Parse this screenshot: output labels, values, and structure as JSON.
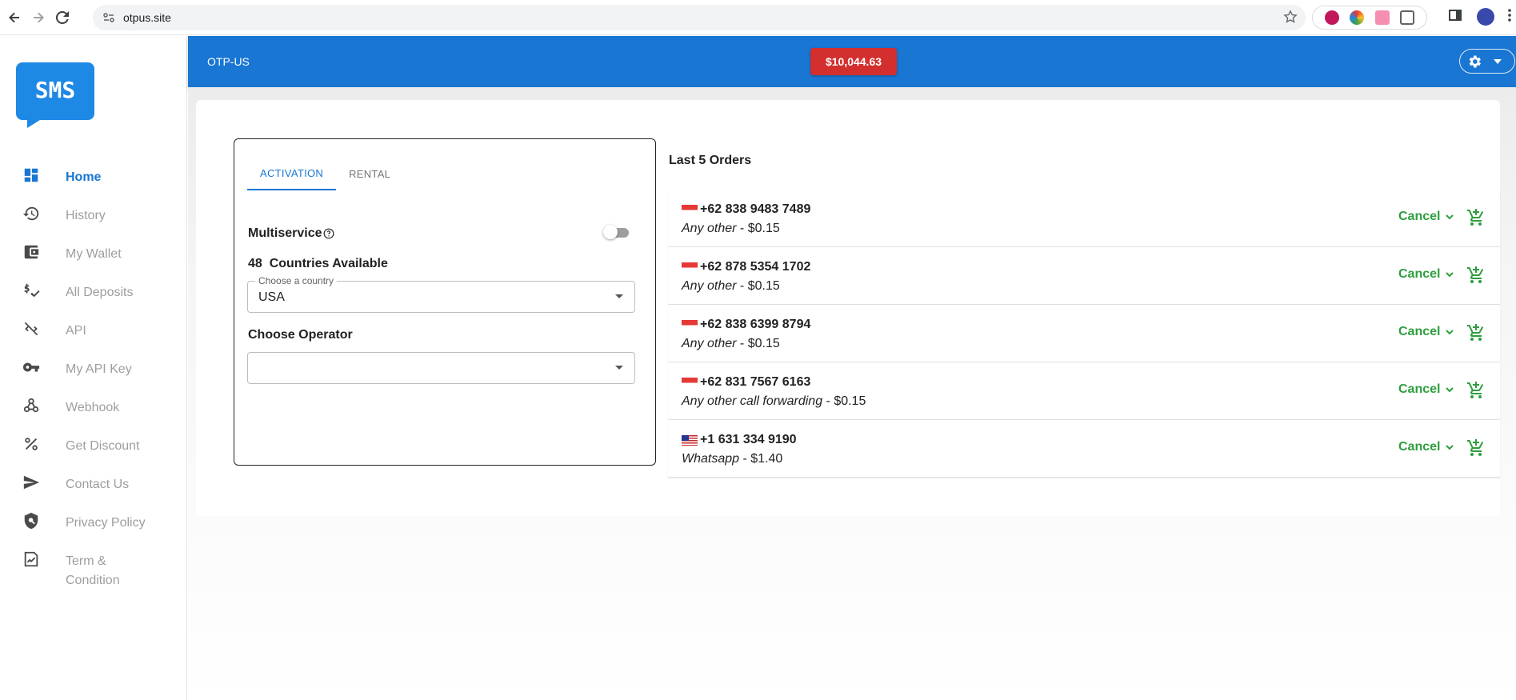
{
  "browser": {
    "url": "otpus.site"
  },
  "sidebar": {
    "logo_text": "SMS",
    "items": [
      {
        "label": "Home",
        "icon": "dashboard-icon",
        "active": true
      },
      {
        "label": "History",
        "icon": "history-icon"
      },
      {
        "label": "My Wallet",
        "icon": "wallet-icon"
      },
      {
        "label": "All Deposits",
        "icon": "deposits-icon"
      },
      {
        "label": "API",
        "icon": "api-icon"
      },
      {
        "label": "My API Key",
        "icon": "key-icon"
      },
      {
        "label": "Webhook",
        "icon": "webhook-icon"
      },
      {
        "label": "Get Discount",
        "icon": "percent-icon"
      },
      {
        "label": "Contact Us",
        "icon": "send-icon"
      },
      {
        "label": "Privacy Policy",
        "icon": "shield-icon"
      },
      {
        "label": "Term & Condition",
        "icon": "terms-icon"
      }
    ]
  },
  "appbar": {
    "brand": "OTP-US",
    "balance": "$10,044.63"
  },
  "activation": {
    "tabs": [
      "ACTIVATION",
      "RENTAL"
    ],
    "multiservice_label": "Multiservice",
    "countries_count": "48",
    "countries_label": "Countries Available",
    "country_field_label": "Choose a country",
    "country_value": "USA",
    "operator_label": "Choose Operator",
    "operator_value": ""
  },
  "orders": {
    "title": "Last 5 Orders",
    "cancel_label": "Cancel",
    "items": [
      {
        "phone": "+62 838 9483 7489",
        "service": "Any other",
        "price": " - $0.15",
        "flag": "id"
      },
      {
        "phone": "+62 878 5354 1702",
        "service": "Any other",
        "price": " - $0.15",
        "flag": "id"
      },
      {
        "phone": "+62 838 6399 8794",
        "service": "Any other",
        "price": " - $0.15",
        "flag": "id"
      },
      {
        "phone": "+62 831 7567 6163",
        "service": "Any other call forwarding",
        "price": " - $0.15",
        "flag": "id"
      },
      {
        "phone": "+1 631 334 9190",
        "service": "Whatsapp",
        "price": " - $1.40",
        "flag": "us"
      }
    ]
  }
}
